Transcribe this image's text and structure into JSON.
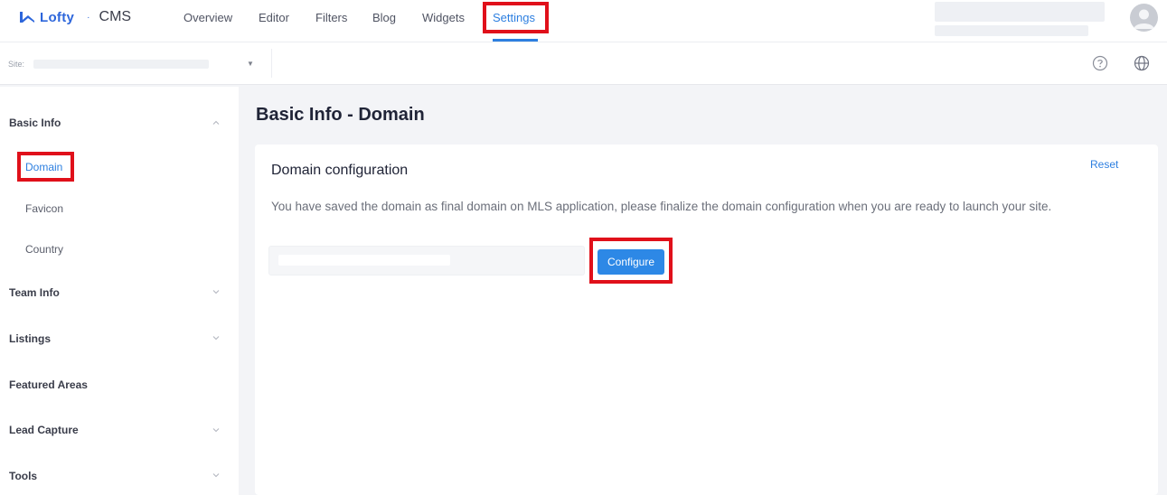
{
  "app": {
    "brand": "Lofty",
    "separator": "·",
    "product": "CMS"
  },
  "nav": {
    "items": [
      {
        "label": "Overview"
      },
      {
        "label": "Editor"
      },
      {
        "label": "Filters"
      },
      {
        "label": "Blog"
      },
      {
        "label": "Widgets"
      },
      {
        "label": "Settings",
        "active": true
      }
    ]
  },
  "sitebar": {
    "site_label": "Site:",
    "help_icon": "question-circle-icon",
    "globe_icon": "globe-icon"
  },
  "sidebar": {
    "groups": [
      {
        "label": "Basic Info",
        "expanded": true,
        "items": [
          "Domain",
          "Favicon",
          "Country"
        ],
        "active_item": "Domain"
      },
      {
        "label": "Team Info",
        "expanded": false
      },
      {
        "label": "Listings",
        "expanded": false
      },
      {
        "label": "Featured Areas"
      },
      {
        "label": "Lead Capture",
        "expanded": false
      },
      {
        "label": "Tools",
        "expanded": false
      }
    ]
  },
  "main": {
    "page_title": "Basic Info - Domain",
    "card": {
      "title": "Domain configuration",
      "reset_label": "Reset",
      "description": "You have saved the domain as final domain on MLS application, please finalize the domain configuration when you are ready to launch your site.",
      "configure_label": "Configure"
    }
  },
  "colors": {
    "accent": "#2d7fe0",
    "highlight": "#e0101a",
    "brand": "#2d66db"
  }
}
